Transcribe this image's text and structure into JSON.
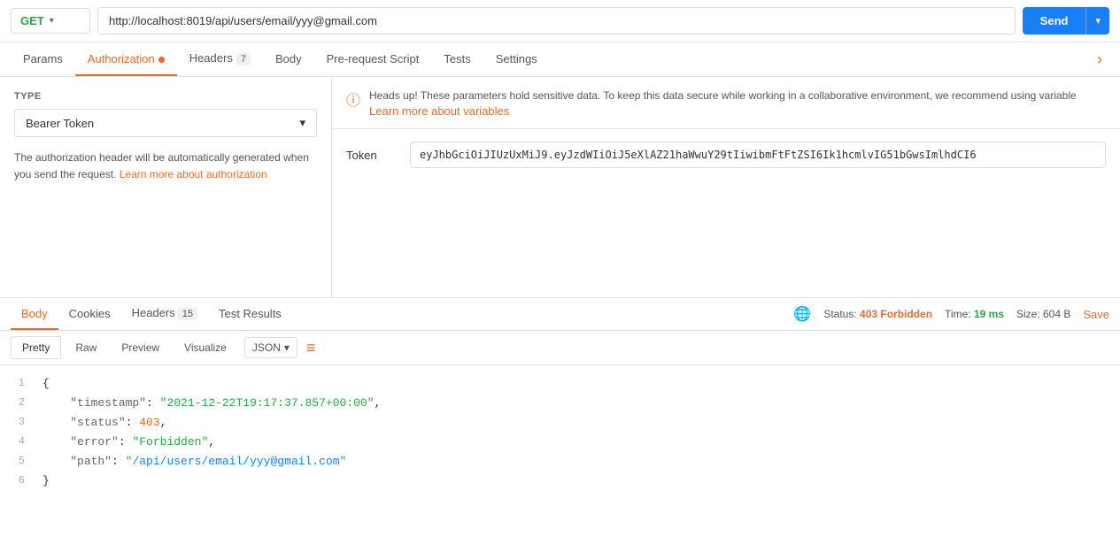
{
  "topbar": {
    "method": "GET",
    "url": "http://localhost:8019/api/users/email/yyy@gmail.com",
    "send_label": "Send"
  },
  "tabs": {
    "items": [
      {
        "id": "params",
        "label": "Params",
        "active": false,
        "dot": false,
        "badge": null
      },
      {
        "id": "authorization",
        "label": "Authorization",
        "active": true,
        "dot": true,
        "badge": null
      },
      {
        "id": "headers",
        "label": "Headers",
        "active": false,
        "dot": false,
        "badge": "7"
      },
      {
        "id": "body",
        "label": "Body",
        "active": false,
        "dot": false,
        "badge": null
      },
      {
        "id": "pre-request",
        "label": "Pre-request Script",
        "active": false,
        "dot": false,
        "badge": null
      },
      {
        "id": "tests",
        "label": "Tests",
        "active": false,
        "dot": false,
        "badge": null
      },
      {
        "id": "settings",
        "label": "Settings",
        "active": false,
        "dot": false,
        "badge": null
      }
    ]
  },
  "auth_panel": {
    "type_label": "TYPE",
    "type_value": "Bearer Token",
    "info_text": "The authorization header will be automatically generated when you send the request.",
    "learn_more_label": "Learn more about authorization",
    "learn_more_url": "#"
  },
  "alert": {
    "message": "Heads up! These parameters hold sensitive data. To keep this data secure while working in a collaborative environment, we recommend using variable",
    "link_label": "Learn more about variables",
    "link_url": "#"
  },
  "token": {
    "label": "Token",
    "value": "eyJhbGciOiJIUzUxMiJ9.eyJzdWIiOiJ5eXlAZ21haWwuY29tIiwibmFtFtZSI6Ik1hcmlvIG51bGwsImlhdCI6"
  },
  "response_tabs": {
    "items": [
      {
        "id": "body",
        "label": "Body",
        "active": true,
        "badge": null
      },
      {
        "id": "cookies",
        "label": "Cookies",
        "active": false,
        "badge": null
      },
      {
        "id": "headers",
        "label": "Headers",
        "active": false,
        "badge": "15"
      },
      {
        "id": "test-results",
        "label": "Test Results",
        "active": false,
        "badge": null
      }
    ],
    "status_label": "Status:",
    "status_value": "403 Forbidden",
    "time_label": "Time:",
    "time_value": "19 ms",
    "size_label": "Size:",
    "size_value": "604 B",
    "save_label": "Save"
  },
  "format_tabs": {
    "items": [
      {
        "id": "pretty",
        "label": "Pretty",
        "active": true
      },
      {
        "id": "raw",
        "label": "Raw",
        "active": false
      },
      {
        "id": "preview",
        "label": "Preview",
        "active": false
      },
      {
        "id": "visualize",
        "label": "Visualize",
        "active": false
      }
    ],
    "json_label": "JSON"
  },
  "code_lines": [
    {
      "num": "1",
      "content": "{"
    },
    {
      "num": "2",
      "content": "  \"timestamp\": \"2021-12-22T19:17:37.857+00:00\","
    },
    {
      "num": "3",
      "content": "  \"status\": 403,"
    },
    {
      "num": "4",
      "content": "  \"error\": \"Forbidden\","
    },
    {
      "num": "5",
      "content": "  \"path\": \"/api/users/email/yyy@gmail.com\""
    },
    {
      "num": "6",
      "content": "}"
    }
  ]
}
